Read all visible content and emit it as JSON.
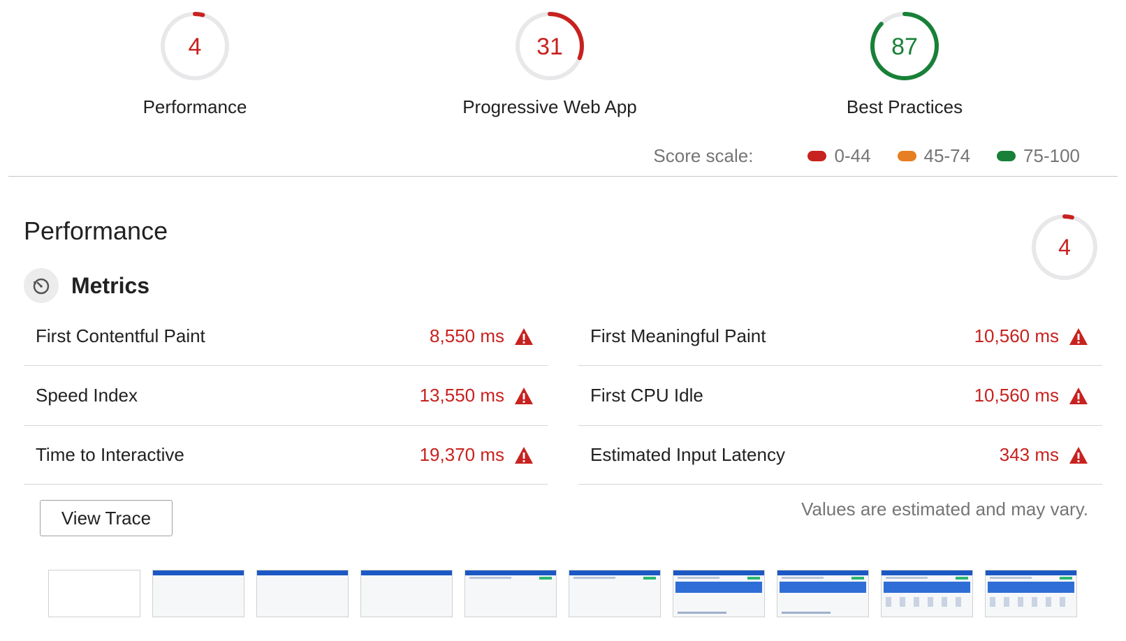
{
  "colors": {
    "fail": "#c7221f",
    "average": "#e67e22",
    "pass": "#188038",
    "track": "#e8e8ea"
  },
  "gauges": [
    {
      "score": "4",
      "label": "Performance",
      "status": "fail",
      "fraction": 0.04
    },
    {
      "score": "31",
      "label": "Progressive Web App",
      "status": "fail",
      "fraction": 0.31
    },
    {
      "score": "87",
      "label": "Best Practices",
      "status": "pass",
      "fraction": 0.87
    }
  ],
  "score_scale": {
    "title": "Score scale:",
    "items": [
      {
        "range": "0-44",
        "color": "#c7221f"
      },
      {
        "range": "45-74",
        "color": "#e67e22"
      },
      {
        "range": "75-100",
        "color": "#188038"
      }
    ]
  },
  "section": {
    "title": "Performance",
    "score": "4",
    "score_fraction": 0.04,
    "metrics_label": "Metrics",
    "metrics_icon": "stopwatch-icon"
  },
  "metrics": {
    "left": [
      {
        "name": "First Contentful Paint",
        "value": "8,550 ms"
      },
      {
        "name": "Speed Index",
        "value": "13,550 ms"
      },
      {
        "name": "Time to Interactive",
        "value": "19,370 ms"
      }
    ],
    "right": [
      {
        "name": "First Meaningful Paint",
        "value": "10,560 ms"
      },
      {
        "name": "First CPU Idle",
        "value": "10,560 ms"
      },
      {
        "name": "Estimated Input Latency",
        "value": "343 ms"
      }
    ],
    "warning_icon": "warning-triangle-icon"
  },
  "actions": {
    "view_trace": "View Trace"
  },
  "note": "Values are estimated and may vary.",
  "filmstrip": {
    "frames": [
      "blank",
      "header",
      "header",
      "header",
      "content",
      "content",
      "panel",
      "panel",
      "full",
      "full"
    ]
  }
}
